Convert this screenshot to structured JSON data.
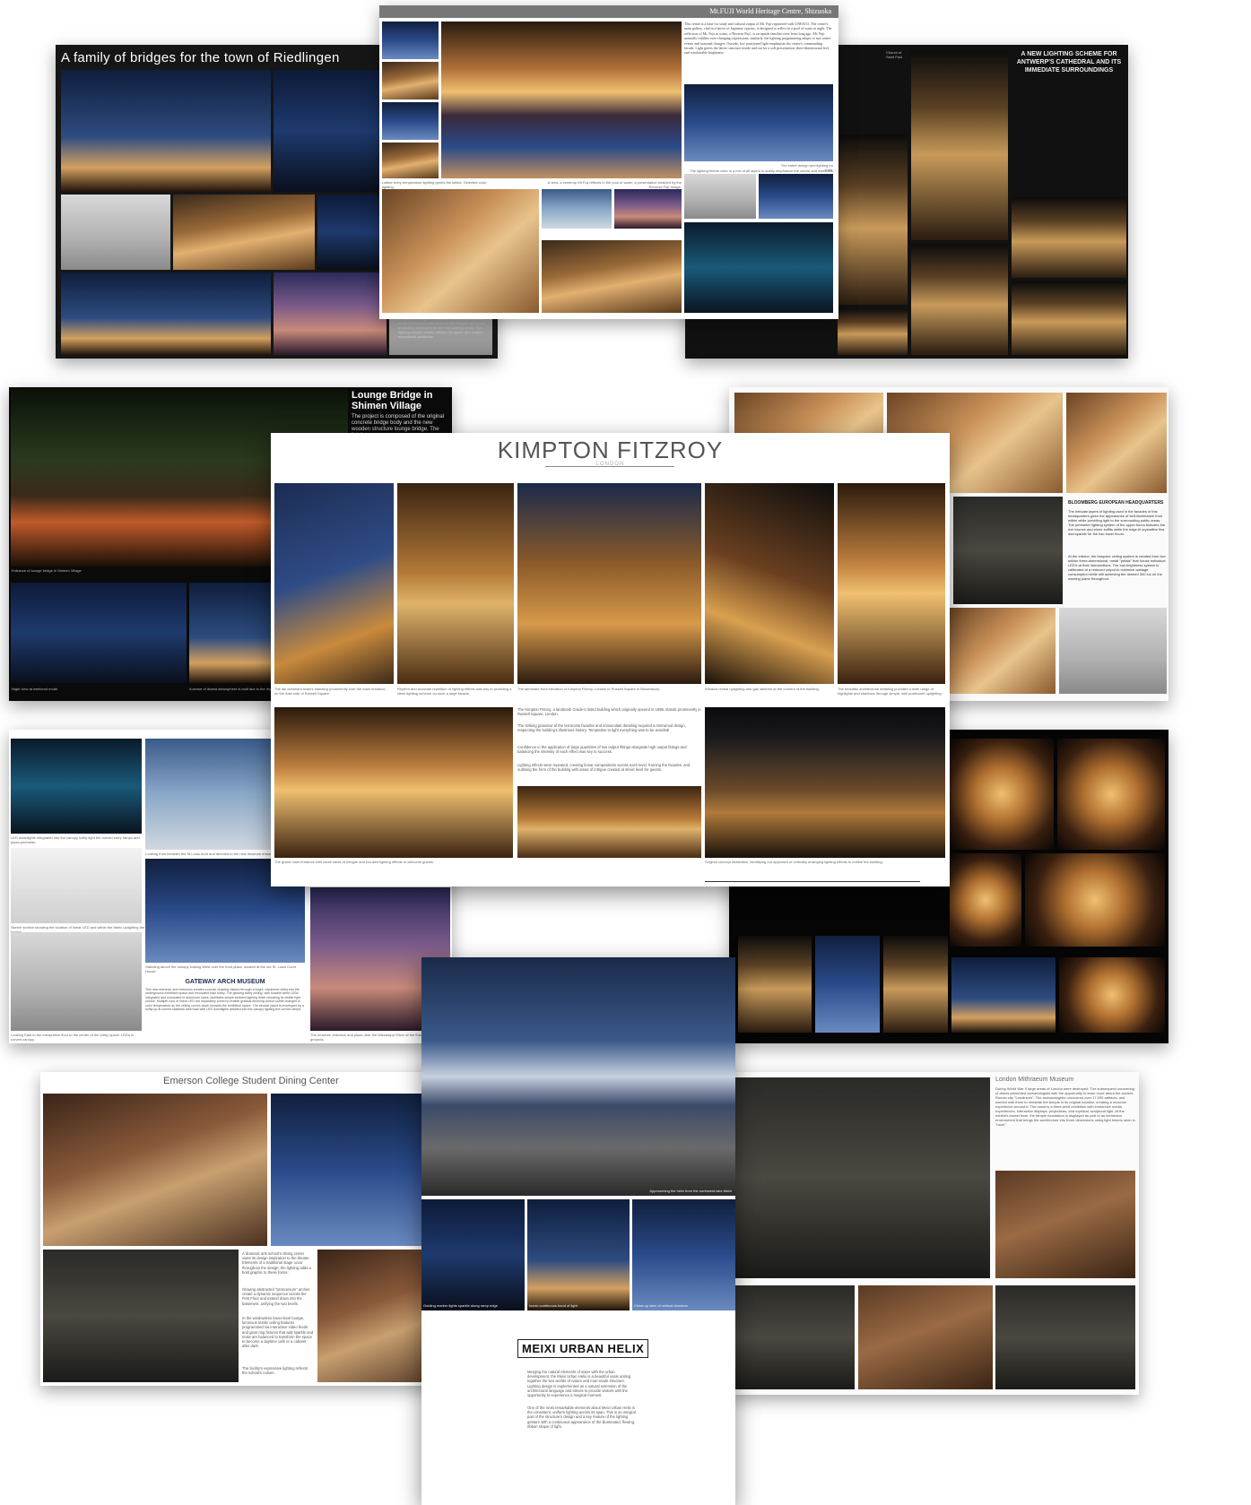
{
  "collage": {
    "riedlingen": {
      "title": "A family of bridges for the town of Riedlingen",
      "body": "to the historic town. The lighting concept accentuates the forms of bridges' impression, combining individual made-to-measure luminaires for the bridges and series production luminaires for the surrounding areas. The lighting solution clearly defines the space and creates exceptional ambience."
    },
    "fuji": {
      "header": "Mt.FUJI World Heritage Centre, Shizuoka",
      "body": "This centre is a base for study and cultural output of Mt. Fuji registered with UNESCO. The centre's main gallery, clad in a lattice of Japanese cypress, is designed to reflect in a pool of water at night. The reflection of Mt. Fuji as water, a 'Reverse Fuji', is an upside familiar view from long ago. Mt. Fuji naturally exhibits ever-changing expressions; similarly, the lighting programming adapts to suit centre events and seasonal changes. Outside, low positioned light emphasises the centre's commanding facade. Light greets the lattice structure inside and out for a soft presentation; three-dimensional feel, and comfortable brightness.",
      "caption_1": "Lattice entry temperature lighting greets the lattice. Selected color lighting.",
      "caption_2": "A view, a centerup Mt Fuji reflects in the pool of water, a presentation enabled by the 'Reverse Fuji' image.",
      "caption_3": "The entire design and lighting for both.",
      "caption_4": "The lighting theme color is a mix of all layers to subtly emphasize the centre and illuminate the stage."
    },
    "antwerp": {
      "title": "A NEW LIGHTING SCHEME FOR ANTWERP'S CATHEDRAL AND ITS IMMEDIATE SURROUNDINGS",
      "label": "Church of Saint Paul"
    },
    "shimen": {
      "title": "Lounge Bridge in Shimen Village",
      "body": "The project is composed of the original concrete bridge body and the new wooden structure lounge bridge. The lighting",
      "caption_1": "Entrance of lounge bridge in Shimen Village",
      "caption_2": "Night view at weekend mode",
      "caption_3": "A sense of drama atmosphere is built due to the rhythm of the"
    },
    "kimpton": {
      "title": "KIMPTON FITZROY",
      "subtitle": "LONDON",
      "captions": [
        "The tall dominant towers standing prominently over the main entrance, on the east side of Russell Square.",
        "Rhythm and accurate repetition of lighting effects was key to providing a sleek lighting scheme on such a large facade.",
        "The landmark front elevation of Kimpton Fitzroy, London in Russell Square in Bloomsbury.",
        "Window reveal uplighting and gas lanterns at the corners of the building.",
        "The beautiful architectural detailing provided a wide range of highlights and shadows through simple, well positioned uplighting."
      ],
      "body_1": "The Kimpton Fitzroy, a landmark Grade-II listed building which originally opened in 1898, stands prominently in Russell Square, London.",
      "body_2": "The striking grandeur of the terracotta facades and immaculate detailing required a restrained design, respecting the building's illustrious history. Temptation to light everything was to be avoided!",
      "body_3": "Confidence in the application of large quantities of low output fittings alongside high output fittings and balancing the intensity of each effect was key to success.",
      "body_4": "Lighting effects were repeated, creating linear compositions across each level, framing the facades, and outlining the form of the building with areas of intrigue created at street level for guests.",
      "caption_bottom_left": "The grand main entrance with small areas of intrigue and focused lighting effects to welcome guests.",
      "caption_bottom_right": "Original concept illustration, identifying our approach of vertically arranging lighting effects to outline the building."
    },
    "bloomberg": {
      "title": "BLOOMBERG EUROPEAN HEADQUARTERS",
      "body_1": "The intricate layers of lighting used in the facades of this headquarters gives the appearance of self-illumination from within while providing light to the surrounding public areas. The perimeter lighting system of the upper floors features the rich bronze and stone soffits while the edge-lit crystalline fins add sparkle for the two lower floors.",
      "body_2": "At the interior, the bespoke ceiling system is created from two million three-dimensional, metal \"petals\" that house individual LED's at their intersections. The low-brightness system is calibrated at a reduced output to minimize wattage consumption while still achieving the desired 300 lux on the working plane throughout."
    },
    "gateway": {
      "title": "GATEWAY ARCH MUSEUM",
      "body": "This new entrance and extension creates a portal, drawing visitors through a bright, expansive lobby into the underground exhibition space and renovated train lobby. The glowing lobby ceiling, with tunable white LEDs integrated and concealed in aluminum tubes, facilitates simple ambient lighting while revealing its visible light source. Multiple runs of linear LED are separately zoned to enable gradual dimming and/or subtle changes in color temperature as the ceiling curves down towards the exhibition space. The circular plaza is enveloped by a softly up-lit curved stainless steel wall with LED downlights detailed into the canopy lighting the curved ramps.",
      "caption_1": "LED downlights integrated into the canopy softly light the curved entry ramps and plaza perimeter.",
      "caption_2": "Looking from beneath the St Louis Arch and directed to the new museum entrance.",
      "caption_3": "Sketch section showing the location of linear LED and within the fabric uplighting the beams",
      "caption_4": "Standing above the canopy looking West over the front plaza, located at the old St. Louis Court House.",
      "caption_5": "Looking East to the interpretive floor to the center of the lobby space. LEDs in curved canopy.",
      "caption_6": "The museum entrance and plaza near the Mississippi River at the East and the grounds."
    },
    "emerson": {
      "title": "Emerson College Student Dining Center",
      "body_1": "A dramatic arts school's dining center owes its design inspiration to the theater. Elements of a traditional stage occur throughout the design; the lighting adds a bold graphic to these forms.",
      "body_2": "Glowing abstracted \"proscenium\" arches create a dynamic sequence across the First Floor and extend down into the basement, unifying the two levels.",
      "body_3": "In the windowless lower-level lounge, luminous textile ceiling features programmed via interactive video feeds and giant ring fixtures that add sparkle and scale are balanced to transform the space to become a daytime café or a cabaret after dark.",
      "body_4": "The facility's expressive lighting reflects the school's culture."
    },
    "meixi": {
      "title": "MEIXI URBAN HELIX",
      "body_1": "Merging the natural elements of water with the urban development, the Meixi Urban Helix is a beautiful oasis uniting together the two worlds of nature and man-made structure. Lighting design is implemented as a natural extension of the architectural language and strives to provide visitors with the opportunity to experience a magical moment.",
      "body_2": "One of the most remarkable elements about Meixi Urban Helix is the consistent, uniform lighting across its span. This is an integral part of the structure's design and a key feature of the lighting gesture with a continuous appearance of the illuminated, flowing, ribbon shape of light.",
      "caption_1": "Approaching the helix from the northwest lake Meixi",
      "caption_2": "Guiding marker lights sparkle along ramp edge",
      "caption_3": "Iconic continuous band of light",
      "caption_4": "Close-up view of vertical structure"
    },
    "mithraeum": {
      "title": "London Mithraeum Museum",
      "body": "During World War II large areas of London were destroyed. The subsequent uncovering of debris presented archaeologists with the opportunity to learn more about the ancient Roman city \"Londinium\". The archaeologists uncovered over 17,000 artifacts, and worked with them to reinstate the temple in its original location, creating a museum experience around it. The result is a three-level exhibition with immersive media experiences, interactive displays, projections, and mystical, sculptural light. At the exhibit's lowest level, the temple foundation is displayed as part of an immersive environment that brings the architecture into three dimensions using light beams seen in \"haze\"."
    }
  }
}
